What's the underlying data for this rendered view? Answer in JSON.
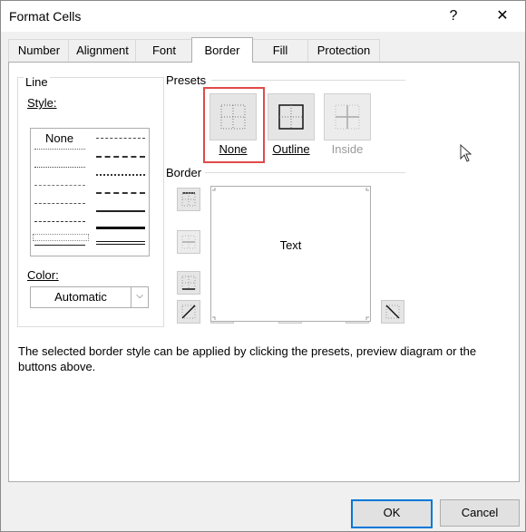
{
  "dialog": {
    "title": "Format Cells",
    "help_glyph": "?",
    "close_glyph": "✕"
  },
  "tabs": [
    {
      "label": "Number"
    },
    {
      "label": "Alignment"
    },
    {
      "label": "Font"
    },
    {
      "label": "Border",
      "active": true
    },
    {
      "label": "Fill"
    },
    {
      "label": "Protection"
    }
  ],
  "line": {
    "group_label": "Line",
    "style_label": "Style:",
    "style_none_label": "None",
    "color_label": "Color:",
    "color_value": "Automatic"
  },
  "presets": {
    "group_label": "Presets",
    "items": [
      {
        "label": "None",
        "selected": true
      },
      {
        "label": "Outline"
      },
      {
        "label": "Inside",
        "disabled": true
      }
    ]
  },
  "border": {
    "group_label": "Border",
    "preview_text": "Text"
  },
  "note": "The selected border style can be applied by clicking the presets, preview diagram or the buttons above.",
  "buttons": {
    "ok": "OK",
    "cancel": "Cancel"
  },
  "colors": {
    "highlight": "#e04a4a",
    "ok_border": "#0078d7"
  }
}
